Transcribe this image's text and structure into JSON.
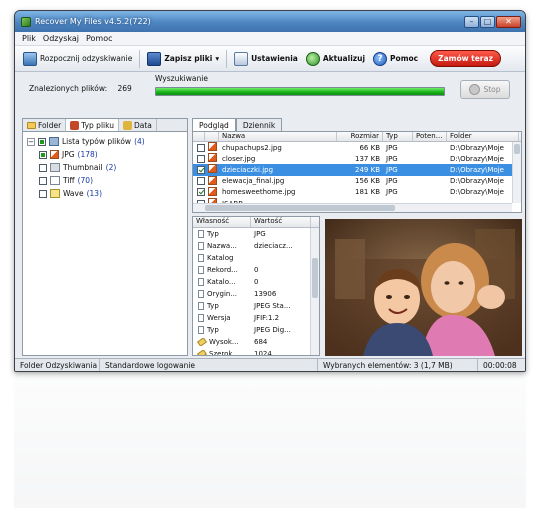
{
  "window": {
    "title": "Recover My Files v4.5.2(722)"
  },
  "menu": [
    "Plik",
    "Odzyskaj",
    "Pomoc"
  ],
  "toolbar": {
    "start": "Rozpocznij odzyskiwanie",
    "save": "Zapisz pliki",
    "settings": "Ustawienia",
    "update": "Aktualizuj",
    "help": "Pomoc",
    "order": "Zamów teraz"
  },
  "status": {
    "found_label": "Znalezionych plików:",
    "found_count": "269",
    "search_label": "Wyszukiwanie",
    "progress": 1.0,
    "stop": "Stop"
  },
  "left_tabs": [
    "Folder",
    "Typ pliku",
    "Data"
  ],
  "tree": {
    "root": {
      "label": "Lista typów plików",
      "count": "(4)"
    },
    "items": [
      {
        "label": "JPG",
        "count": "(178)",
        "checked": true
      },
      {
        "label": "Thumbnail",
        "count": "(2)",
        "checked": false
      },
      {
        "label": "Tiff",
        "count": "(70)",
        "checked": false
      },
      {
        "label": "Wave",
        "count": "(13)",
        "checked": false
      }
    ]
  },
  "right_tabs": [
    "Podgląd",
    "Dziennik"
  ],
  "files": {
    "columns": [
      "Nazwa",
      "Rozmiar",
      "Typ",
      "Poten...",
      "Folder"
    ],
    "rows": [
      {
        "name": "chupachups2.jpg",
        "size": "66 KB",
        "type": "JPG",
        "folder": "D:\\Obrazy\\Moje",
        "checked": false,
        "selected": false
      },
      {
        "name": "closer.jpg",
        "size": "137 KB",
        "type": "JPG",
        "folder": "D:\\Obrazy\\Moje",
        "checked": false,
        "selected": false
      },
      {
        "name": "dzieciaczki.jpg",
        "size": "249 KB",
        "type": "JPG",
        "folder": "D:\\Obrazy\\Moje",
        "checked": true,
        "selected": true
      },
      {
        "name": "elewacja_final.jpg",
        "size": "156 KB",
        "type": "JPG",
        "folder": "D:\\Obrazy\\Moje",
        "checked": false,
        "selected": false
      },
      {
        "name": "homesweethome.jpg",
        "size": "181 KB",
        "type": "JPG",
        "folder": "D:\\Obrazy\\Moje",
        "checked": true,
        "selected": false
      },
      {
        "name": "ISABB...",
        "size": "",
        "type": "",
        "folder": "",
        "checked": false,
        "selected": false
      }
    ]
  },
  "properties": {
    "columns": [
      "Własność",
      "Wartość"
    ],
    "rows": [
      {
        "name": "Typ",
        "value": "JPG",
        "icon": "doc"
      },
      {
        "name": "Nazwa...",
        "value": "dzieciacz...",
        "icon": "doc"
      },
      {
        "name": "Katalog",
        "value": "",
        "icon": "doc"
      },
      {
        "name": "Rekord...",
        "value": "0",
        "icon": "doc"
      },
      {
        "name": "Katalo...",
        "value": "0",
        "icon": "doc"
      },
      {
        "name": "Orygin...",
        "value": "13906",
        "icon": "doc"
      },
      {
        "name": "Typ",
        "value": "JPEG Sta...",
        "icon": "doc"
      },
      {
        "name": "Wersja",
        "value": "JFIF:1.2",
        "icon": "doc"
      },
      {
        "name": "Typ",
        "value": "JPEG Dig...",
        "icon": "doc"
      },
      {
        "name": "Wysok...",
        "value": "684",
        "icon": "ruler"
      },
      {
        "name": "Szerok...",
        "value": "1024",
        "icon": "ruler"
      }
    ]
  },
  "statusbar": {
    "folder": "Folder Odzyskiwania",
    "mode": "Standardowe logowanie",
    "selected": "Wybranych elementów: 3 (1,7 MB)",
    "time": "00:00:08"
  }
}
